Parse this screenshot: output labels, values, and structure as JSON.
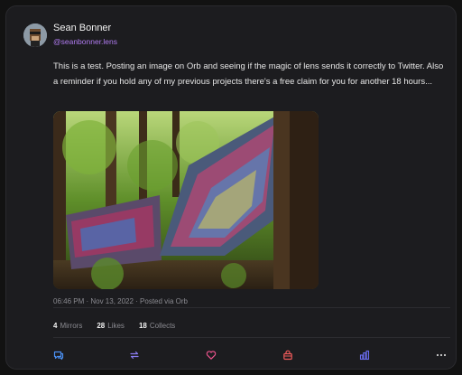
{
  "author": {
    "name": "Sean Bonner",
    "handle": "@seanbonner.lens"
  },
  "post": {
    "text": "This is a test. Posting an image on Orb and seeing if the magic of lens sends it correctly to Twitter. Also a reminder if you hold any of my previous projects there's a free claim for you for another 18 hours...",
    "meta": "06:46 PM · Nov 13, 2022 · Posted via Orb"
  },
  "stats": {
    "mirrors_count": "4",
    "mirrors_label": "Mirrors",
    "likes_count": "28",
    "likes_label": "Likes",
    "collects_count": "18",
    "collects_label": "Collects"
  },
  "actions": {
    "comment_icon": "comment-icon",
    "mirror_icon": "mirror-icon",
    "like_icon": "heart-icon",
    "collect_icon": "collect-bag-icon",
    "stats_icon": "stats-icon",
    "more_icon": "more-icon"
  },
  "colors": {
    "background": "#1c1c1f",
    "handle": "#b07bf0",
    "comment": "#4a8ff0",
    "mirror": "#8a7cf0",
    "like": "#f0558f",
    "collect": "#f05a5a",
    "stats": "#6a6cf0"
  }
}
